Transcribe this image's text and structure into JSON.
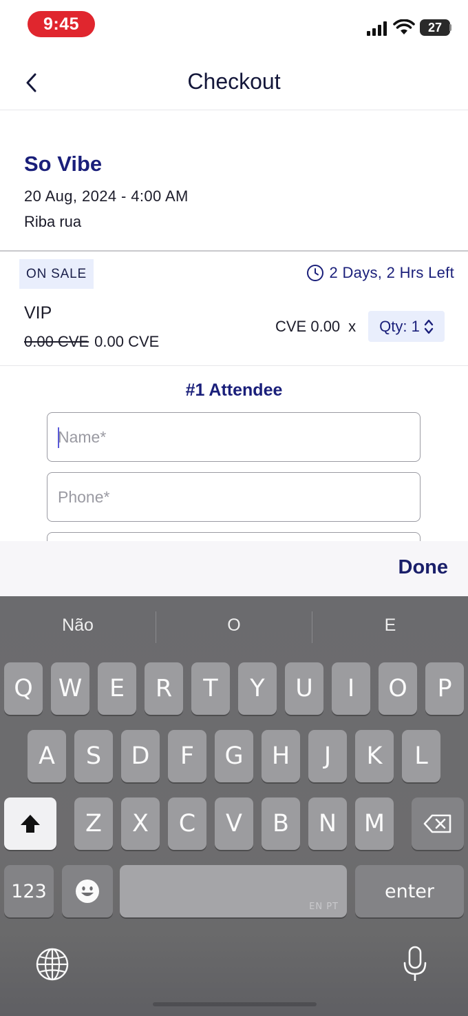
{
  "status_bar": {
    "time": "9:45",
    "battery": "27"
  },
  "header": {
    "title": "Checkout"
  },
  "event": {
    "name": "So Vibe",
    "date": "20 Aug, 2024 - 4:00 AM",
    "venue": "Riba rua"
  },
  "ticket": {
    "sale_badge": "ON SALE",
    "time_left": "2 Days, 2 Hrs Left",
    "name": "VIP",
    "original_price": "0.00 CVE",
    "price": "0.00 CVE",
    "line_price": "CVE 0.00",
    "multiply": "x",
    "qty_label": "Qty: 1"
  },
  "attendee": {
    "title": "#1 Attendee",
    "name_placeholder": "Name*",
    "phone_placeholder": "Phone*"
  },
  "keyboard": {
    "done_label": "Done",
    "suggestions": [
      "Não",
      "O",
      "E"
    ],
    "row1": [
      "Q",
      "W",
      "E",
      "R",
      "T",
      "Y",
      "U",
      "I",
      "O",
      "P"
    ],
    "row2": [
      "A",
      "S",
      "D",
      "F",
      "G",
      "H",
      "J",
      "K",
      "L"
    ],
    "row3": [
      "Z",
      "X",
      "C",
      "V",
      "B",
      "N",
      "M"
    ],
    "numbers_label": "123",
    "space_lang": "EN PT",
    "enter_label": "enter"
  },
  "colors": {
    "accent": "#1a1f7a",
    "status_time": "#e0262e",
    "badge_bg": "#e9eefc"
  }
}
